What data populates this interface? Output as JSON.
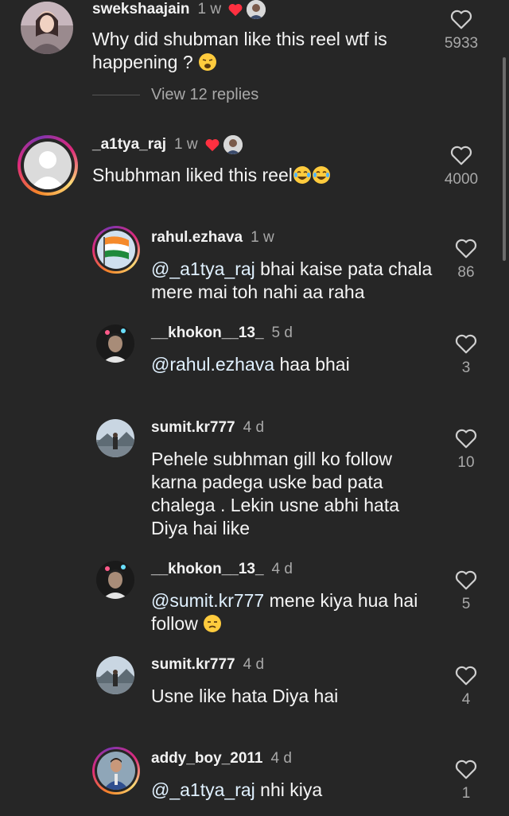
{
  "comments": [
    {
      "username": "swekshaajain",
      "time": "1 w",
      "text": "Why did shubman like this reel wtf is happening ?",
      "likes": "5933",
      "view_replies": "View 12 replies"
    },
    {
      "username": "_a1tya_raj",
      "time": "1 w",
      "text": "Shubhman liked this reel",
      "likes": "4000"
    }
  ],
  "replies": [
    {
      "username": "rahul.ezhava",
      "time": "1 w",
      "mention": "@_a1tya_raj",
      "text": " bhai kaise pata chala mere mai toh nahi aa raha",
      "likes": "86"
    },
    {
      "username": "__khokon__13_",
      "time": "5 d",
      "mention": "@rahul.ezhava",
      "text": " haa bhai",
      "likes": "3"
    },
    {
      "username": "sumit.kr777",
      "time": "4 d",
      "mention": "",
      "text": "Pehele subhman gill ko follow karna padega uske bad pata chalega . Lekin usne abhi hata Diya hai like",
      "likes": "10"
    },
    {
      "username": "__khokon__13_",
      "time": "4 d",
      "mention": "@sumit.kr777",
      "text": " mene kiya hua hai follow",
      "likes": "5"
    },
    {
      "username": "sumit.kr777",
      "time": "4 d",
      "mention": "",
      "text": "Usne like hata Diya hai",
      "likes": "4"
    },
    {
      "username": "addy_boy_2011",
      "time": "4 d",
      "mention": "@_a1tya_raj",
      "text": " nhi kiya",
      "likes": "1"
    }
  ],
  "colors": {
    "background": "#262626",
    "mention": "#e0f1ff",
    "secondary": "#a8a8a8",
    "heart_red": "#ff3040"
  },
  "icons": {
    "like": "heart-outline-icon",
    "author_like": "heart-filled-icon",
    "emoji_weary": "weary-face-emoji",
    "emoji_laugh": "tears-of-joy-emoji",
    "emoji_unamused": "unamused-face-emoji"
  }
}
